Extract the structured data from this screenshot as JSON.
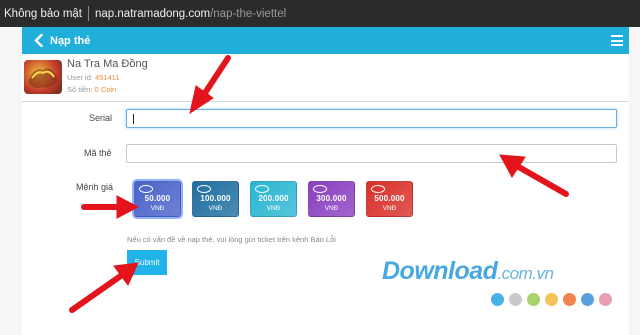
{
  "browser": {
    "security_label": "Không bảo mật",
    "url_host": "nap.natramadong.com",
    "url_path": "/nap-the-viettel"
  },
  "header": {
    "title": "Nạp thẻ",
    "back_icon": "chevron-left-icon",
    "menu_icon": "hamburger-icon",
    "bg_color": "#20aedb"
  },
  "profile": {
    "game_name": "Na Tra Ma Đồng",
    "user_id_label": "User id:",
    "user_id": "451411",
    "balance_label": "Số tiền:",
    "balance": "0 Coin"
  },
  "form": {
    "serial_label": "Serial",
    "serial_value": "",
    "code_label": "Mã thẻ",
    "code_value": "",
    "denomination_label": "Mệnh giá",
    "cards": [
      {
        "amount": "50.000",
        "currency": "VNĐ",
        "color": "#4a63c9",
        "selected": true
      },
      {
        "amount": "100.000",
        "currency": "VNĐ",
        "color": "#1f6fa0",
        "selected": false
      },
      {
        "amount": "200.000",
        "currency": "VNĐ",
        "color": "#2bb6d2",
        "selected": false
      },
      {
        "amount": "300.000",
        "currency": "VNĐ",
        "color": "#8a3fbf",
        "selected": false
      },
      {
        "amount": "500.000",
        "currency": "VNĐ",
        "color": "#d9302a",
        "selected": false
      }
    ],
    "help_text": "Nếu có vấn đề về nạp thẻ, vui lòng gửi ticket trên kênh Báo Lỗi",
    "submit_label": "Submit",
    "submit_color": "#1fb3ea"
  },
  "watermark": {
    "brand": "Download",
    "suffix": ".com.vn",
    "dot_colors": [
      "#4ab0e8",
      "#c9c9c9",
      "#a7d36a",
      "#f6c35a",
      "#f2844f",
      "#5aa0e0",
      "#e8a0b0"
    ]
  },
  "annotation_color": "#e3141b"
}
